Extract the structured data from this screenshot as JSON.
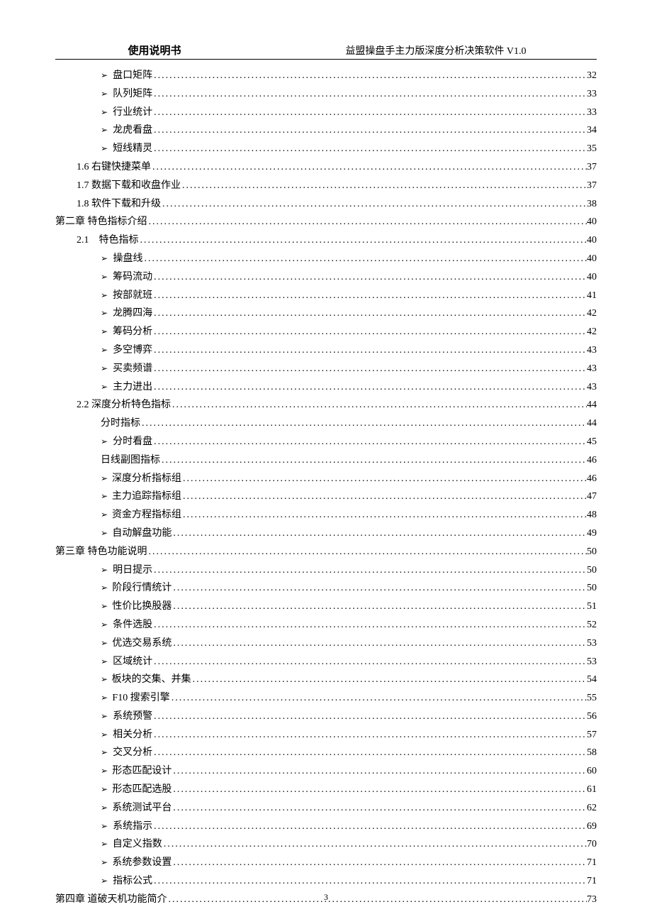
{
  "header": {
    "left": "使用说明书",
    "right": "益盟操盘手主力版深度分析决策软件 V1.0"
  },
  "page_number": "3",
  "toc": [
    {
      "level": 3,
      "bullet": true,
      "label": "盘口矩阵",
      "page": "32"
    },
    {
      "level": 3,
      "bullet": true,
      "label": "队列矩阵",
      "page": "33"
    },
    {
      "level": 3,
      "bullet": true,
      "label": "行业统计",
      "page": "33"
    },
    {
      "level": 3,
      "bullet": true,
      "label": "龙虎看盘",
      "page": "34"
    },
    {
      "level": 3,
      "bullet": true,
      "label": "短线精灵",
      "page": "35"
    },
    {
      "level": 1,
      "bullet": false,
      "label": "1.6 右键快捷菜单",
      "page": "37"
    },
    {
      "level": 1,
      "bullet": false,
      "label": "1.7 数据下载和收盘作业",
      "page": "37"
    },
    {
      "level": 1,
      "bullet": false,
      "label": "1.8 软件下载和升级",
      "page": "38"
    },
    {
      "level": 0,
      "bullet": false,
      "label": "第二章 特色指标介绍",
      "page": "40"
    },
    {
      "level": 1,
      "bullet": false,
      "label": "2.1　特色指标",
      "page": "40"
    },
    {
      "level": 3,
      "bullet": true,
      "label": "操盘线",
      "page": "40"
    },
    {
      "level": 3,
      "bullet": true,
      "label": "筹码流动",
      "page": "40"
    },
    {
      "level": 3,
      "bullet": true,
      "label": "按部就班",
      "page": "41"
    },
    {
      "level": 3,
      "bullet": true,
      "label": "龙腾四海",
      "page": "42"
    },
    {
      "level": 3,
      "bullet": true,
      "label": "筹码分析",
      "page": "42"
    },
    {
      "level": 3,
      "bullet": true,
      "label": "多空博弈",
      "page": "43"
    },
    {
      "level": 3,
      "bullet": true,
      "label": "买卖频谱",
      "page": "43"
    },
    {
      "level": 3,
      "bullet": true,
      "label": "主力进出",
      "page": "43"
    },
    {
      "level": 1,
      "bullet": false,
      "label": "2.2 深度分析特色指标",
      "page": "44"
    },
    {
      "level": 2,
      "bullet": false,
      "label": "分时指标",
      "page": "44"
    },
    {
      "level": 3,
      "bullet": true,
      "label": "分时看盘",
      "page": "45"
    },
    {
      "level": 2,
      "bullet": false,
      "label": "日线副图指标",
      "page": "46"
    },
    {
      "level": 3,
      "bullet": true,
      "label": "深度分析指标组",
      "page": "46"
    },
    {
      "level": 3,
      "bullet": true,
      "label": "主力追踪指标组",
      "page": "47"
    },
    {
      "level": 3,
      "bullet": true,
      "label": "资金方程指标组",
      "page": "48"
    },
    {
      "level": 3,
      "bullet": true,
      "label": "自动解盘功能",
      "page": "49"
    },
    {
      "level": 0,
      "bullet": false,
      "label": "第三章 特色功能说明",
      "page": "50"
    },
    {
      "level": 3,
      "bullet": true,
      "label": "明日提示",
      "page": "50"
    },
    {
      "level": 3,
      "bullet": true,
      "label": "阶段行情统计",
      "page": "50"
    },
    {
      "level": 3,
      "bullet": true,
      "label": "性价比换股器",
      "page": "51"
    },
    {
      "level": 3,
      "bullet": true,
      "label": "条件选股",
      "page": "52"
    },
    {
      "level": 3,
      "bullet": true,
      "label": "优选交易系统",
      "page": "53"
    },
    {
      "level": 3,
      "bullet": true,
      "label": "区域统计",
      "page": "53"
    },
    {
      "level": 3,
      "bullet": true,
      "label": "板块的交集、并集",
      "page": "54"
    },
    {
      "level": 3,
      "bullet": true,
      "label": "F10 搜索引擎",
      "page": "55"
    },
    {
      "level": 3,
      "bullet": true,
      "label": "系统预警",
      "page": "56"
    },
    {
      "level": 3,
      "bullet": true,
      "label": "相关分析",
      "page": "57"
    },
    {
      "level": 3,
      "bullet": true,
      "label": "交叉分析",
      "page": "58"
    },
    {
      "level": 3,
      "bullet": true,
      "label": "形态匹配设计",
      "page": "60"
    },
    {
      "level": 3,
      "bullet": true,
      "label": "形态匹配选股",
      "page": "61"
    },
    {
      "level": 3,
      "bullet": true,
      "label": "系统测试平台",
      "page": "62"
    },
    {
      "level": 3,
      "bullet": true,
      "label": "系统指示",
      "page": "69"
    },
    {
      "level": 3,
      "bullet": true,
      "label": "自定义指数",
      "page": "70"
    },
    {
      "level": 3,
      "bullet": true,
      "label": "系统参数设置",
      "page": "71"
    },
    {
      "level": 3,
      "bullet": true,
      "label": "指标公式",
      "page": "71"
    },
    {
      "level": 0,
      "bullet": false,
      "label": "第四章 道破天机功能简介",
      "page": "73"
    }
  ]
}
